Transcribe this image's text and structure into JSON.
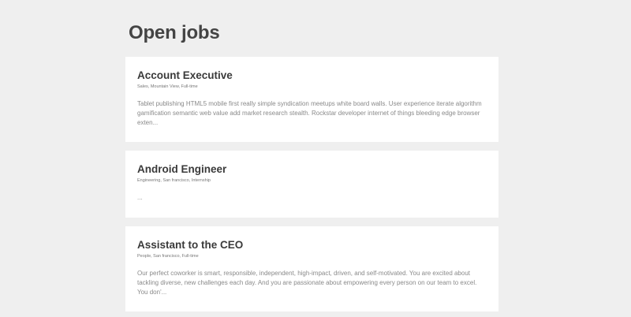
{
  "page": {
    "title": "Open jobs"
  },
  "jobs": [
    {
      "title": "Account Executive",
      "meta": "Sales, Mountain View, Full-time",
      "description": "Tablet publishing HTML5 mobile first really simple syndication meetups white board walls. User experience iterate algorithm gamification semantic web value add market research stealth. Rockstar developer internet of things bleeding edge browser exten..."
    },
    {
      "title": "Android Engineer",
      "meta": "Engineering, San francisco, Internship",
      "description": "..."
    },
    {
      "title": "Assistant to the CEO",
      "meta": "People, San francisco, Full-time",
      "description": "Our perfect coworker is smart, responsible, independent, high-impact, driven, and self-motivated. You are excited about tackling diverse, new challenges each day. And you are passionate about empowering every person on our team to excel. You don'..."
    }
  ]
}
